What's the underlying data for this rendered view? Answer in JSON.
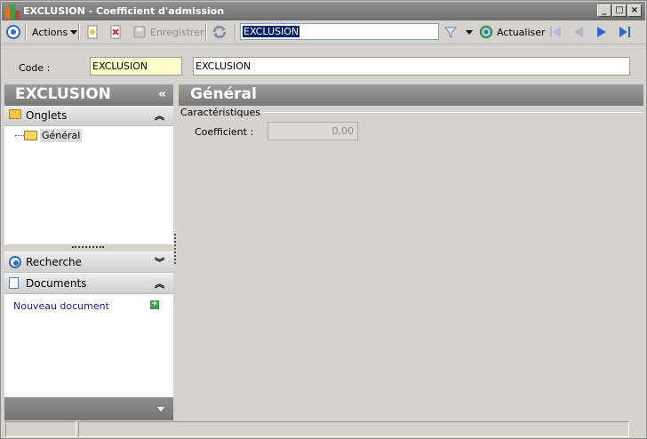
{
  "window": {
    "title": "EXCLUSION -  Coefficient d'admission",
    "min_glyph": "_",
    "max_glyph": "□",
    "close_glyph": "×"
  },
  "toolbar": {
    "actions_label": "Actions",
    "save_label": "Enregistrer",
    "search_value": "EXCLUSION",
    "refresh_label": "Actualiser",
    "icons": [
      "nav-circle-icon",
      "new-document-icon",
      "delete-icon",
      "save-icon",
      "sync-icon",
      "filter-icon",
      "refresh-icon",
      "first-icon",
      "previous-icon",
      "next-icon",
      "last-icon"
    ]
  },
  "form": {
    "code_label": "Code :",
    "code_value": "EXCLUSION",
    "libelle_value": "EXCLUSION"
  },
  "left_panel": {
    "title": "EXCLUSION",
    "collapse_glyph": "«",
    "onglets_label": "Onglets",
    "onglets_chevron": "︽",
    "tree_item": "Général",
    "recherche_label": "Recherche",
    "recherche_chevron": "︾",
    "documents_label": "Documents",
    "documents_chevron": "︽",
    "new_document": "Nouveau document",
    "add_glyph": "+"
  },
  "right_panel": {
    "title": "Général",
    "group_title": "Caractéristiques",
    "coefficient_label": "Coefficient :",
    "coefficient_value": "0,00"
  },
  "colors": {
    "header_gray": "#8a8a8a",
    "window_bg": "#d6d3ce",
    "code_field_bg": "#ffffc8",
    "link_blue": "#1a1aa8",
    "accent_blue": "#2f6bc6"
  }
}
